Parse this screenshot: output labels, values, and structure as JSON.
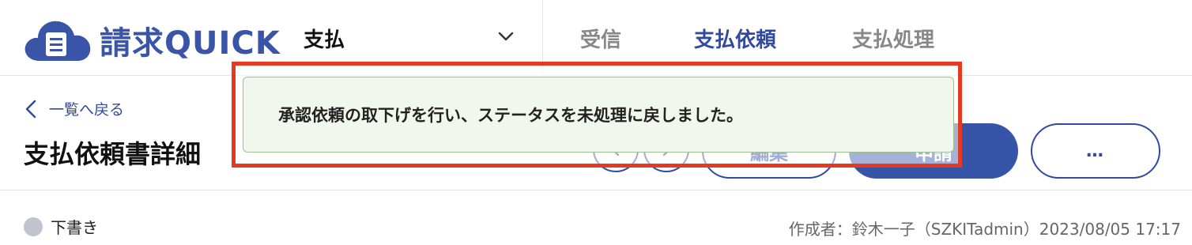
{
  "header": {
    "logo_text": "請求QUICK",
    "app_selector": {
      "value": "支払"
    },
    "tabs": [
      {
        "label": "受信"
      },
      {
        "label": "支払依頼"
      },
      {
        "label": "支払処理"
      }
    ]
  },
  "page": {
    "back_link": "一覧へ戻る",
    "title": "支払依頼書詳細",
    "actions": {
      "edit_label": "編集",
      "apply_label": "申請",
      "more_label": "…"
    }
  },
  "status": {
    "label": "下書き",
    "meta": "作成者：鈴木一子（SZKITadmin）2023/08/05 17:17"
  },
  "toast": {
    "message": "承認依頼の取下げを行い、ステータスを未処理に戻しました。"
  },
  "colors": {
    "brand": "#3a55a8",
    "active_tab": "#2f4aa0",
    "highlight": "#e53a22",
    "toast_bg": "#f2f7ee"
  }
}
